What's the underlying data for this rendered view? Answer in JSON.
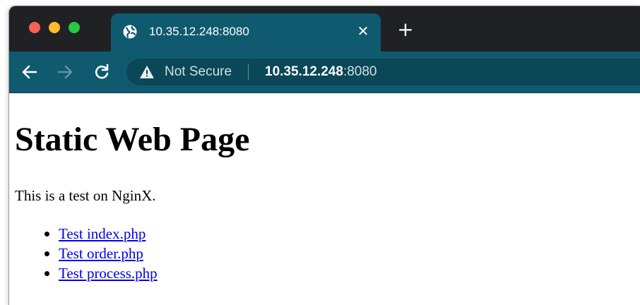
{
  "browser": {
    "tab": {
      "title": "10.35.12.248:8080",
      "close_glyph": "✕",
      "favicon": "globe-icon"
    },
    "new_tab_glyph": "+",
    "toolbar": {
      "back_icon": "arrow-left-icon",
      "forward_icon": "arrow-right-icon",
      "reload_icon": "reload-icon"
    },
    "omnibox": {
      "security_label": "Not Secure",
      "security_icon": "warning-triangle-icon",
      "host": "10.35.12.248",
      "port": ":8080"
    },
    "colors": {
      "titlebar": "#202124",
      "tab": "#0f5a6e",
      "toolbar": "#0f5a6e",
      "omnibox": "#0a4757",
      "traffic_close": "#fe5f57",
      "traffic_minimize": "#febc2e",
      "traffic_maximize": "#28c840",
      "link": "#0000ee"
    }
  },
  "page": {
    "title": "Static Web Page",
    "paragraph": "This is a test on NginX.",
    "links": [
      {
        "label": "Test index.php"
      },
      {
        "label": "Test order.php"
      },
      {
        "label": "Test process.php"
      }
    ]
  }
}
